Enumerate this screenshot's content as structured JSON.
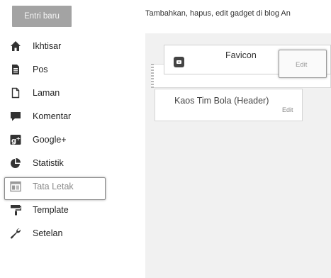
{
  "toolbar": {
    "new_post_label": "Entri baru"
  },
  "description": "Tambahkan, hapus, edit gadget di blog An",
  "sidebar": {
    "items": [
      {
        "label": "Ikhtisar",
        "icon": "home-icon"
      },
      {
        "label": "Pos",
        "icon": "document-icon"
      },
      {
        "label": "Laman",
        "icon": "page-icon"
      },
      {
        "label": "Komentar",
        "icon": "comment-icon"
      },
      {
        "label": "Google+",
        "icon": "google-plus-icon"
      },
      {
        "label": "Statistik",
        "icon": "pie-chart-icon"
      },
      {
        "label": "Tata Letak",
        "icon": "layout-icon",
        "active": true
      },
      {
        "label": "Template",
        "icon": "paint-roller-icon"
      },
      {
        "label": "Setelan",
        "icon": "wrench-icon"
      }
    ]
  },
  "layout": {
    "gadgets": [
      {
        "title": "Favicon",
        "edit_label": "Edit"
      },
      {
        "title": "Kaos Tim Bola (Header)",
        "edit_label": "Edit"
      }
    ]
  },
  "colors": {
    "button_bg": "#a3a3a3",
    "canvas_bg": "#f1f1f1",
    "icon": "#333333",
    "active_text": "#888888"
  }
}
